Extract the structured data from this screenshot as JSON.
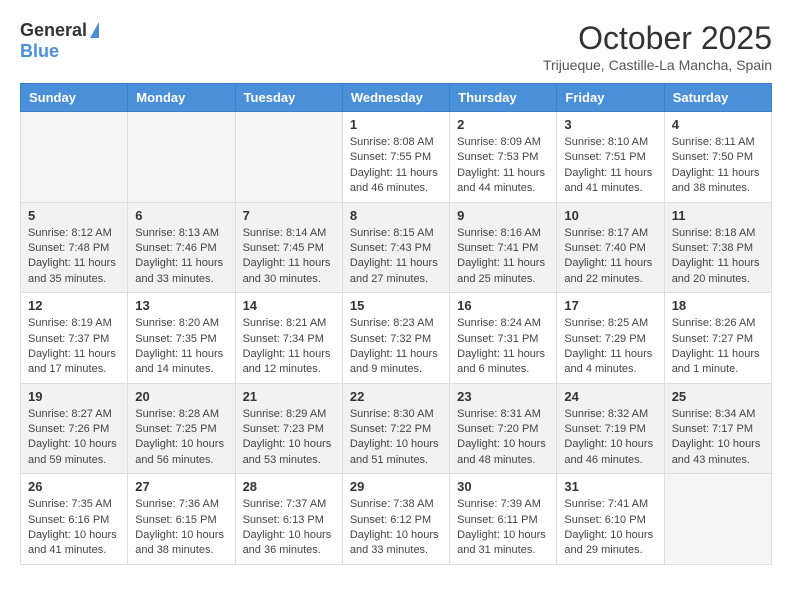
{
  "header": {
    "logo_general": "General",
    "logo_blue": "Blue",
    "month_title": "October 2025",
    "location": "Trijueque, Castille-La Mancha, Spain"
  },
  "weekdays": [
    "Sunday",
    "Monday",
    "Tuesday",
    "Wednesday",
    "Thursday",
    "Friday",
    "Saturday"
  ],
  "weeks": [
    [
      {
        "day": "",
        "info": ""
      },
      {
        "day": "",
        "info": ""
      },
      {
        "day": "",
        "info": ""
      },
      {
        "day": "1",
        "info": "Sunrise: 8:08 AM\nSunset: 7:55 PM\nDaylight: 11 hours\nand 46 minutes."
      },
      {
        "day": "2",
        "info": "Sunrise: 8:09 AM\nSunset: 7:53 PM\nDaylight: 11 hours\nand 44 minutes."
      },
      {
        "day": "3",
        "info": "Sunrise: 8:10 AM\nSunset: 7:51 PM\nDaylight: 11 hours\nand 41 minutes."
      },
      {
        "day": "4",
        "info": "Sunrise: 8:11 AM\nSunset: 7:50 PM\nDaylight: 11 hours\nand 38 minutes."
      }
    ],
    [
      {
        "day": "5",
        "info": "Sunrise: 8:12 AM\nSunset: 7:48 PM\nDaylight: 11 hours\nand 35 minutes."
      },
      {
        "day": "6",
        "info": "Sunrise: 8:13 AM\nSunset: 7:46 PM\nDaylight: 11 hours\nand 33 minutes."
      },
      {
        "day": "7",
        "info": "Sunrise: 8:14 AM\nSunset: 7:45 PM\nDaylight: 11 hours\nand 30 minutes."
      },
      {
        "day": "8",
        "info": "Sunrise: 8:15 AM\nSunset: 7:43 PM\nDaylight: 11 hours\nand 27 minutes."
      },
      {
        "day": "9",
        "info": "Sunrise: 8:16 AM\nSunset: 7:41 PM\nDaylight: 11 hours\nand 25 minutes."
      },
      {
        "day": "10",
        "info": "Sunrise: 8:17 AM\nSunset: 7:40 PM\nDaylight: 11 hours\nand 22 minutes."
      },
      {
        "day": "11",
        "info": "Sunrise: 8:18 AM\nSunset: 7:38 PM\nDaylight: 11 hours\nand 20 minutes."
      }
    ],
    [
      {
        "day": "12",
        "info": "Sunrise: 8:19 AM\nSunset: 7:37 PM\nDaylight: 11 hours\nand 17 minutes."
      },
      {
        "day": "13",
        "info": "Sunrise: 8:20 AM\nSunset: 7:35 PM\nDaylight: 11 hours\nand 14 minutes."
      },
      {
        "day": "14",
        "info": "Sunrise: 8:21 AM\nSunset: 7:34 PM\nDaylight: 11 hours\nand 12 minutes."
      },
      {
        "day": "15",
        "info": "Sunrise: 8:23 AM\nSunset: 7:32 PM\nDaylight: 11 hours\nand 9 minutes."
      },
      {
        "day": "16",
        "info": "Sunrise: 8:24 AM\nSunset: 7:31 PM\nDaylight: 11 hours\nand 6 minutes."
      },
      {
        "day": "17",
        "info": "Sunrise: 8:25 AM\nSunset: 7:29 PM\nDaylight: 11 hours\nand 4 minutes."
      },
      {
        "day": "18",
        "info": "Sunrise: 8:26 AM\nSunset: 7:27 PM\nDaylight: 11 hours\nand 1 minute."
      }
    ],
    [
      {
        "day": "19",
        "info": "Sunrise: 8:27 AM\nSunset: 7:26 PM\nDaylight: 10 hours\nand 59 minutes."
      },
      {
        "day": "20",
        "info": "Sunrise: 8:28 AM\nSunset: 7:25 PM\nDaylight: 10 hours\nand 56 minutes."
      },
      {
        "day": "21",
        "info": "Sunrise: 8:29 AM\nSunset: 7:23 PM\nDaylight: 10 hours\nand 53 minutes."
      },
      {
        "day": "22",
        "info": "Sunrise: 8:30 AM\nSunset: 7:22 PM\nDaylight: 10 hours\nand 51 minutes."
      },
      {
        "day": "23",
        "info": "Sunrise: 8:31 AM\nSunset: 7:20 PM\nDaylight: 10 hours\nand 48 minutes."
      },
      {
        "day": "24",
        "info": "Sunrise: 8:32 AM\nSunset: 7:19 PM\nDaylight: 10 hours\nand 46 minutes."
      },
      {
        "day": "25",
        "info": "Sunrise: 8:34 AM\nSunset: 7:17 PM\nDaylight: 10 hours\nand 43 minutes."
      }
    ],
    [
      {
        "day": "26",
        "info": "Sunrise: 7:35 AM\nSunset: 6:16 PM\nDaylight: 10 hours\nand 41 minutes."
      },
      {
        "day": "27",
        "info": "Sunrise: 7:36 AM\nSunset: 6:15 PM\nDaylight: 10 hours\nand 38 minutes."
      },
      {
        "day": "28",
        "info": "Sunrise: 7:37 AM\nSunset: 6:13 PM\nDaylight: 10 hours\nand 36 minutes."
      },
      {
        "day": "29",
        "info": "Sunrise: 7:38 AM\nSunset: 6:12 PM\nDaylight: 10 hours\nand 33 minutes."
      },
      {
        "day": "30",
        "info": "Sunrise: 7:39 AM\nSunset: 6:11 PM\nDaylight: 10 hours\nand 31 minutes."
      },
      {
        "day": "31",
        "info": "Sunrise: 7:41 AM\nSunset: 6:10 PM\nDaylight: 10 hours\nand 29 minutes."
      },
      {
        "day": "",
        "info": ""
      }
    ]
  ]
}
